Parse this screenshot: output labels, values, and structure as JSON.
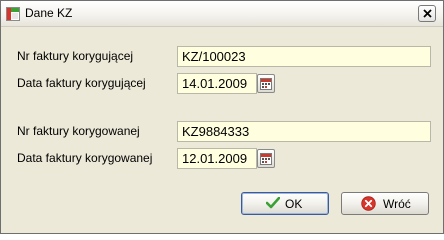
{
  "window": {
    "title": "Dane KZ"
  },
  "form": {
    "correcting_invoice_number_label": "Nr faktury korygującej",
    "correcting_invoice_number_value": "KZ/100023",
    "correcting_invoice_date_label": "Data faktury korygującej",
    "correcting_invoice_date_value": "14.01.2009",
    "corrected_invoice_number_label": "Nr faktury korygowanej",
    "corrected_invoice_number_value": "KZ9884333",
    "corrected_invoice_date_label": "Data faktury korygowanej",
    "corrected_invoice_date_value": "12.01.2009"
  },
  "buttons": {
    "ok_label": "OK",
    "back_label": "Wróć"
  },
  "icons": {
    "app": "app-icon",
    "close": "close-icon",
    "calendar": "calendar-icon",
    "ok": "checkmark-icon",
    "back": "cancel-icon"
  },
  "colors": {
    "field_background": "#ffffe0",
    "window_background": "#ece9d8",
    "ok_check": "#3aa135",
    "cancel_red": "#d9342b"
  }
}
